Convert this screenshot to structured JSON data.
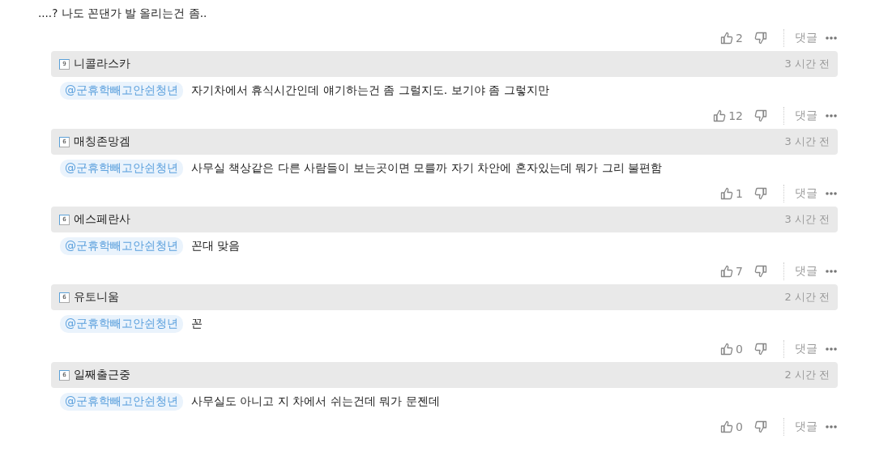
{
  "comment": {
    "text": "....? 나도 꼰댄가 발 올리는건 좀..",
    "likes": "2",
    "reply_label": "댓글"
  },
  "replies": [
    {
      "level": "9",
      "author": "니콜라스카",
      "time": "3 시간 전",
      "mention": "@군휴학빼고안쉰청년",
      "text": "자기차에서 휴식시간인데 얘기하는건 좀 그럴지도. 보기야 좀 그렇지만",
      "likes": "12",
      "reply_label": "댓글"
    },
    {
      "level": "6",
      "author": "매칭존망겜",
      "time": "3 시간 전",
      "mention": "@군휴학빼고안쉰청년",
      "text": "사무실 책상같은 다른 사람들이 보는곳이면 모를까 자기 차안에 혼자있는데 뭐가 그리 불편함",
      "likes": "1",
      "reply_label": "댓글"
    },
    {
      "level": "6",
      "author": "에스페란사",
      "time": "3 시간 전",
      "mention": "@군휴학빼고안쉰청년",
      "text": "꼰대 맞음",
      "likes": "7",
      "reply_label": "댓글"
    },
    {
      "level": "6",
      "author": "유토니움",
      "time": "2 시간 전",
      "mention": "@군휴학빼고안쉰청년",
      "text": "꼰",
      "likes": "0",
      "reply_label": "댓글"
    },
    {
      "level": "6",
      "author": "일째출근중",
      "time": "2 시간 전",
      "mention": "@군휴학빼고안쉰청년",
      "text": "사무실도 아니고 지 차에서 쉬는건데 뭐가 문젠데",
      "likes": "0",
      "reply_label": "댓글"
    }
  ]
}
